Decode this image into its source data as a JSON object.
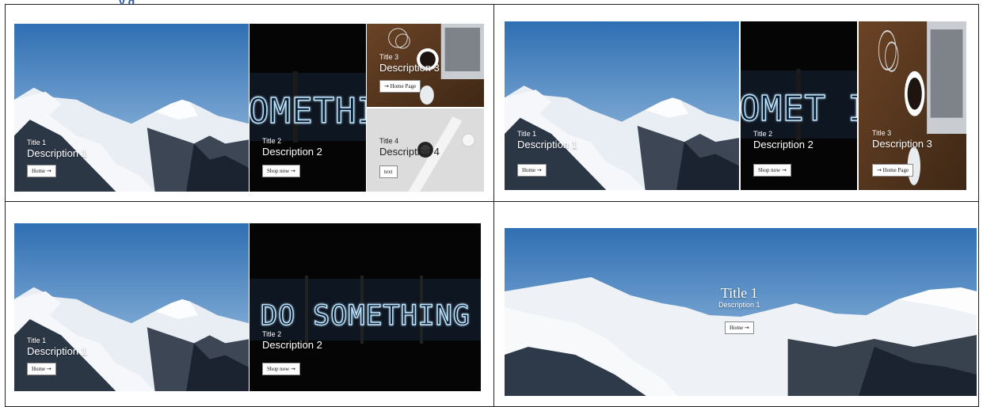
{
  "header_fragment": "y g",
  "colors": {
    "sky_top": "#2f6fb3",
    "sky_bottom": "#9fc3e4",
    "neon": "#bfe6ff",
    "wood": "#5a3a22",
    "watch_bg": "#dcdcdc",
    "header_text": "#2b59a5"
  },
  "panel1": {
    "slide1": {
      "title": "Title 1",
      "description": "Description 1",
      "button": "Home"
    },
    "slide2": {
      "title": "Title 2",
      "description": "Description 2",
      "button": "Shop now",
      "neon": "OMETHING G"
    },
    "slide3": {
      "title": "Title 3",
      "description": "Description 3",
      "button": "Home Page"
    },
    "slide4": {
      "title": "Title 4",
      "description": "Description 4",
      "button": "text"
    }
  },
  "panel2": {
    "slide1": {
      "title": "Title 1",
      "description": "Description 1",
      "button": "Home"
    },
    "slide2": {
      "title": "Title 2",
      "description": "Description 2",
      "button": "Shop now",
      "neon": "OMET ING G"
    },
    "slide3": {
      "title": "Title 3",
      "description": "Description 3",
      "button": "Home Page"
    }
  },
  "panel3": {
    "slide1": {
      "title": "Title 1",
      "description": "Description 1",
      "button": "Home"
    },
    "slide2": {
      "title": "Title 2",
      "description": "Description 2",
      "button": "Shop now",
      "neon": "DO SOMETHING GREAT"
    }
  },
  "panel4": {
    "slide1": {
      "title": "Title 1",
      "description": "Description 1",
      "button": "Home"
    }
  },
  "icons": {
    "arrow": "arrow-right-icon"
  }
}
